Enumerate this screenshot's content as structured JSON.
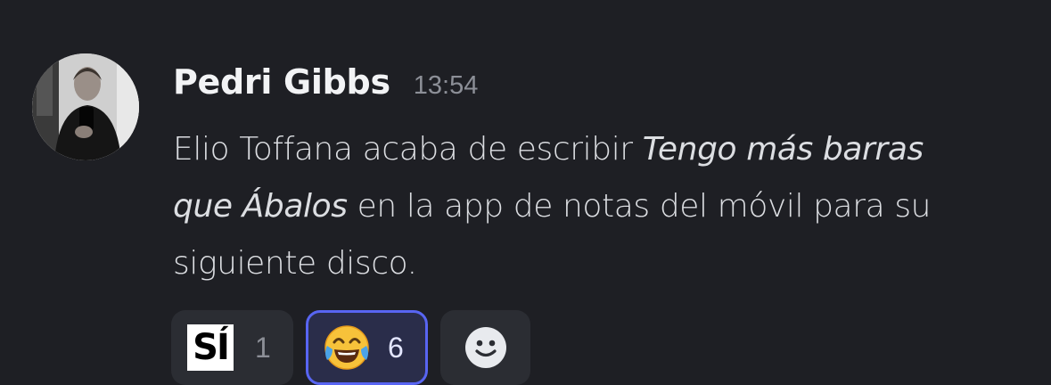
{
  "message": {
    "author": "Pedri Gibbs",
    "timestamp": "13:54",
    "text_parts": {
      "part1": "Elio Toffana acaba de escribir ",
      "italic": "Tengo más barras que Ábalos",
      "part2": " en la app de notas del móvil para su siguiente disco."
    }
  },
  "reactions": [
    {
      "emoji_name": "si-emoji",
      "emoji_text": "SÍ",
      "count": "1",
      "selected": false
    },
    {
      "emoji_name": "joy-emoji",
      "count": "6",
      "selected": true
    }
  ],
  "add_reaction": {
    "icon": "smiley-add-reaction-icon"
  },
  "colors": {
    "background": "#1e1f24",
    "selected_border": "#5865f2",
    "selected_bg": "#2a2d4a",
    "chip_bg": "#2b2d33"
  }
}
